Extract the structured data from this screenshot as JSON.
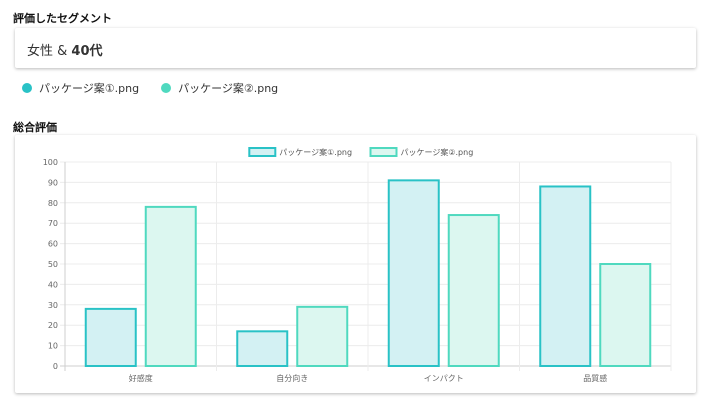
{
  "segment": {
    "heading": "評価したセグメント",
    "gender": "女性 &",
    "age": "40代"
  },
  "files": [
    {
      "name": "パッケージ案①.png",
      "color": "#29c2c6"
    },
    {
      "name": "パッケージ案②.png",
      "color": "#4fd9bf"
    }
  ],
  "overall": {
    "heading": "総合評価"
  },
  "chart_data": {
    "type": "bar",
    "categories": [
      "好感度",
      "自分向き",
      "インパクト",
      "品質感"
    ],
    "series": [
      {
        "name": "パッケージ案①.png",
        "values": [
          28,
          17,
          91,
          88
        ],
        "border": "#29c2c6",
        "fill": "#d3f1f3"
      },
      {
        "name": "パッケージ案②.png",
        "values": [
          78,
          29,
          74,
          50
        ],
        "border": "#4fd9bf",
        "fill": "#dcf7f0"
      }
    ],
    "ylim": [
      0,
      100
    ],
    "yticks": [
      0,
      10,
      20,
      30,
      40,
      50,
      60,
      70,
      80,
      90,
      100
    ],
    "grid": true,
    "legend": "top-center",
    "title": "",
    "xlabel": "",
    "ylabel": ""
  }
}
